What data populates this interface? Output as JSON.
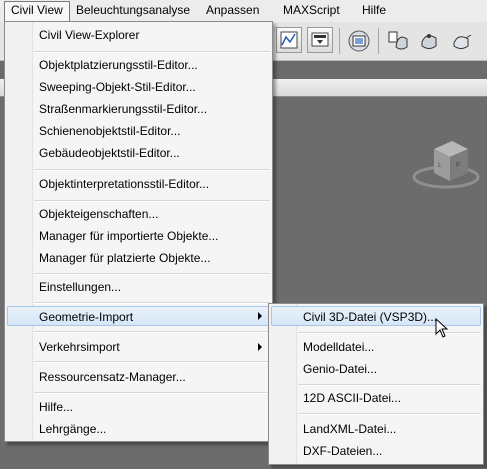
{
  "menubar": {
    "items": [
      "Civil View",
      "Beleuchtungsanalyse",
      "Anpassen",
      "MAXScript",
      "Hilfe"
    ],
    "active": "Civil View"
  },
  "toolbar": {
    "icons": [
      "graph-editor-icon",
      "render-setup-icon",
      "rendered-frame-window-icon",
      "render-production-icon",
      "render-iterative-icon",
      "render-activeshade-icon"
    ]
  },
  "main_menu": {
    "items": [
      "Civil View-Explorer",
      "Objektplatzierungsstil-Editor...",
      "Sweeping-Objekt-Stil-Editor...",
      "Straßenmarkierungsstil-Editor...",
      "Schienenobjektstil-Editor...",
      "Gebäudeobjektstil-Editor...",
      "Objektinterpretationsstil-Editor...",
      "Objekteigenschaften...",
      "Manager für importierte Objekte...",
      "Manager für platzierte Objekte...",
      "Einstellungen...",
      "Geometrie-Import",
      "Verkehrsimport",
      "Ressourcensatz-Manager...",
      "Hilfe...",
      "Lehrgänge..."
    ],
    "highlighted": "Geometrie-Import"
  },
  "sub_menu": {
    "items": [
      "Civil 3D-Datei (VSP3D)...",
      "Modelldatei...",
      "Genio-Datei...",
      "12D ASCII-Datei...",
      "LandXML-Datei...",
      "DXF-Dateien..."
    ],
    "highlighted": "Civil 3D-Datei (VSP3D)..."
  },
  "colors": {
    "highlight": "#d6e6f7",
    "highlight_border": "#a9c6e8",
    "viewport": "#6c6c6c",
    "menu_bg": "#f5f5f5"
  }
}
